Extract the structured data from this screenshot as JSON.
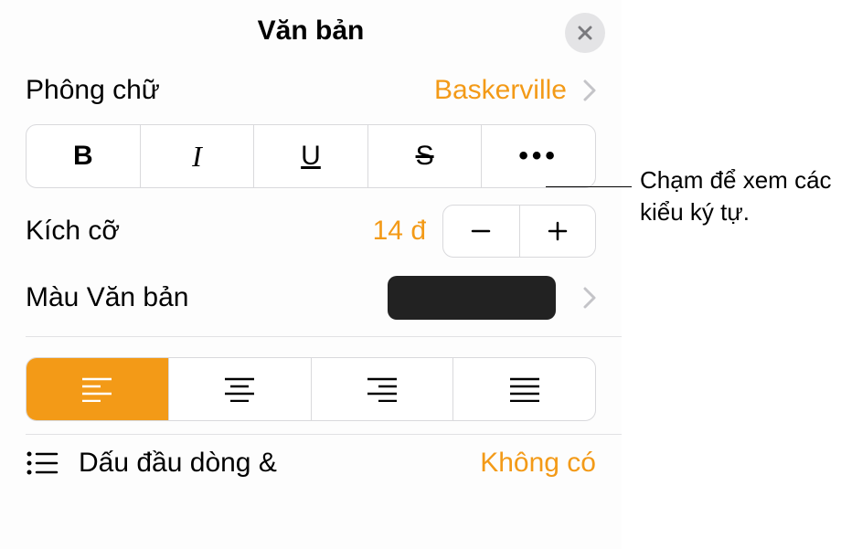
{
  "header": {
    "title": "Văn bản"
  },
  "font": {
    "label": "Phông chữ",
    "value": "Baskerville"
  },
  "styleButtons": {
    "bold": "B",
    "italic": "I",
    "underline": "U",
    "strike": "S",
    "more": "•••"
  },
  "size": {
    "label": "Kích cỡ",
    "value": "14 đ"
  },
  "textColor": {
    "label": "Màu Văn bản",
    "swatch": "#222222"
  },
  "alignment": {
    "active": 0
  },
  "bullets": {
    "label": "Dấu đầu dòng &",
    "value": "Không có"
  },
  "callout": {
    "text": "Chạm để xem các kiểu ký tự."
  }
}
